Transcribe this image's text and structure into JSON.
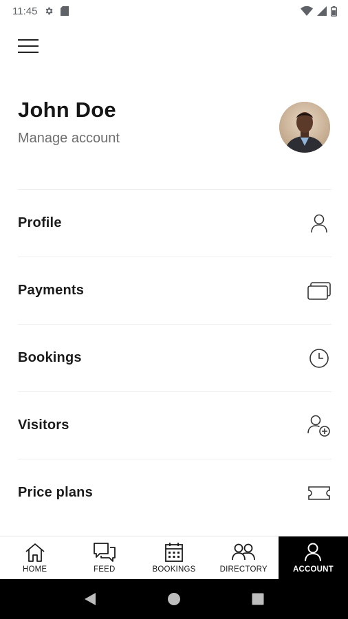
{
  "status_bar": {
    "time": "11:45"
  },
  "header": {
    "name": "John Doe",
    "subtitle": "Manage account"
  },
  "menu": [
    {
      "label": "Profile",
      "icon": "person-icon"
    },
    {
      "label": "Payments",
      "icon": "cards-icon"
    },
    {
      "label": "Bookings",
      "icon": "clock-icon"
    },
    {
      "label": "Visitors",
      "icon": "person-add-icon"
    },
    {
      "label": "Price plans",
      "icon": "ticket-icon"
    }
  ],
  "bottom_nav": [
    {
      "label": "HOME",
      "icon": "home-icon",
      "active": false
    },
    {
      "label": "FEED",
      "icon": "chat-icon",
      "active": false
    },
    {
      "label": "BOOKINGS",
      "icon": "calendar-icon",
      "active": false
    },
    {
      "label": "DIRECTORY",
      "icon": "people-icon",
      "active": false
    },
    {
      "label": "ACCOUNT",
      "icon": "person-icon",
      "active": true
    }
  ],
  "colors": {
    "active_nav_bg": "#000000",
    "subtitle": "#6e6e6e"
  }
}
